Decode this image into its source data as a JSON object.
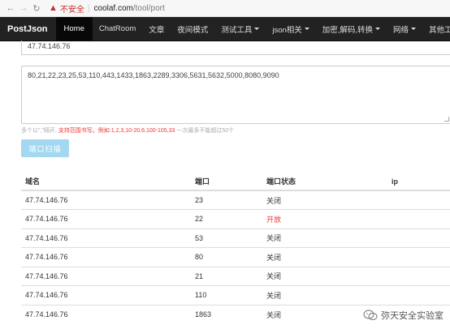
{
  "browser": {
    "back_icon": "←",
    "forward_icon": "→",
    "reload_icon": "↻",
    "warning_icon": "▲",
    "security_label": "不安全",
    "separator": "|",
    "url_host": "coolaf.com",
    "url_path": "/tool/port"
  },
  "navbar": {
    "brand": "PostJson",
    "items": [
      {
        "label": "Home",
        "active": true,
        "dropdown": false
      },
      {
        "label": "ChatRoom",
        "dropdown": false
      },
      {
        "label": "文章",
        "dropdown": false
      },
      {
        "label": "夜间模式",
        "dropdown": false
      },
      {
        "label": "测试工具",
        "dropdown": true
      },
      {
        "label": "json相关",
        "dropdown": true
      },
      {
        "label": "加密,解码,转换",
        "dropdown": true
      },
      {
        "label": "网络",
        "dropdown": true
      },
      {
        "label": "其他工",
        "dropdown": false
      }
    ]
  },
  "form": {
    "ip_value": "47.74.146.76",
    "ports_value": "80,21,22,23,25,53,110,443,1433,1863,2289,3306,5631,5632,5000,8080,9090",
    "hint_prefix": "多个以\",\"隔开,",
    "hint_highlight": "支持范围书写。例如:1,2,3,10-20,6,100-105,33",
    "hint_suffix": "一次最多不能超过50个",
    "scan_button": "端口扫描"
  },
  "table": {
    "headers": [
      "域名",
      "端口",
      "端口状态",
      "ip"
    ],
    "rows": [
      {
        "domain": "47.74.146.76",
        "port": "23",
        "status": "关闭",
        "ip": ""
      },
      {
        "domain": "47.74.146.76",
        "port": "22",
        "status": "开放",
        "ip": ""
      },
      {
        "domain": "47.74.146.76",
        "port": "53",
        "status": "关闭",
        "ip": ""
      },
      {
        "domain": "47.74.146.76",
        "port": "80",
        "status": "关闭",
        "ip": ""
      },
      {
        "domain": "47.74.146.76",
        "port": "21",
        "status": "关闭",
        "ip": ""
      },
      {
        "domain": "47.74.146.76",
        "port": "110",
        "status": "关闭",
        "ip": ""
      },
      {
        "domain": "47.74.146.76",
        "port": "1863",
        "status": "关闭",
        "ip": ""
      }
    ]
  },
  "watermark": {
    "text": "弥天安全实验室"
  }
}
